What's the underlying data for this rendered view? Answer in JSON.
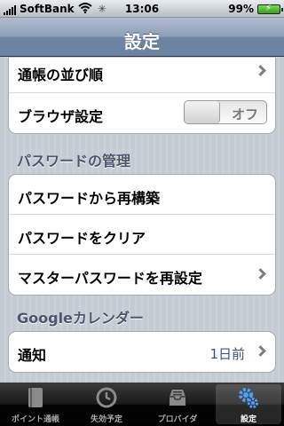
{
  "status_bar": {
    "carrier": "SoftBank",
    "time": "13:06",
    "battery_percent": "99%",
    "battery_level": 0.99,
    "wifi_icon": "wifi-icon",
    "activity_icon": "activity-spinner-icon"
  },
  "nav": {
    "title": "設定"
  },
  "groups": {
    "general": {
      "account_order": "通帳の並び順",
      "browser_settings": "ブラウザ設定",
      "browser_toggle": "オフ"
    },
    "password": {
      "header": "パスワードの管理",
      "rebuild": "パスワードから再構築",
      "clear": "パスワードをクリア",
      "reset_master": "マスターパスワードを再設定"
    },
    "google": {
      "header": "Googleカレンダー",
      "notify": "通知",
      "notify_value": "1日前"
    }
  },
  "tabs": [
    {
      "label": "ポイント通帳",
      "icon": "book-icon"
    },
    {
      "label": "失効予定",
      "icon": "clock-icon"
    },
    {
      "label": "プロバイダ",
      "icon": "inbox-tray-icon"
    },
    {
      "label": "設定",
      "icon": "gears-icon"
    }
  ],
  "colors": {
    "nav_bar": "#6d84a2",
    "section_text": "#4c566c",
    "detail_text": "#385487",
    "tab_selected": "#4aa0ff"
  }
}
